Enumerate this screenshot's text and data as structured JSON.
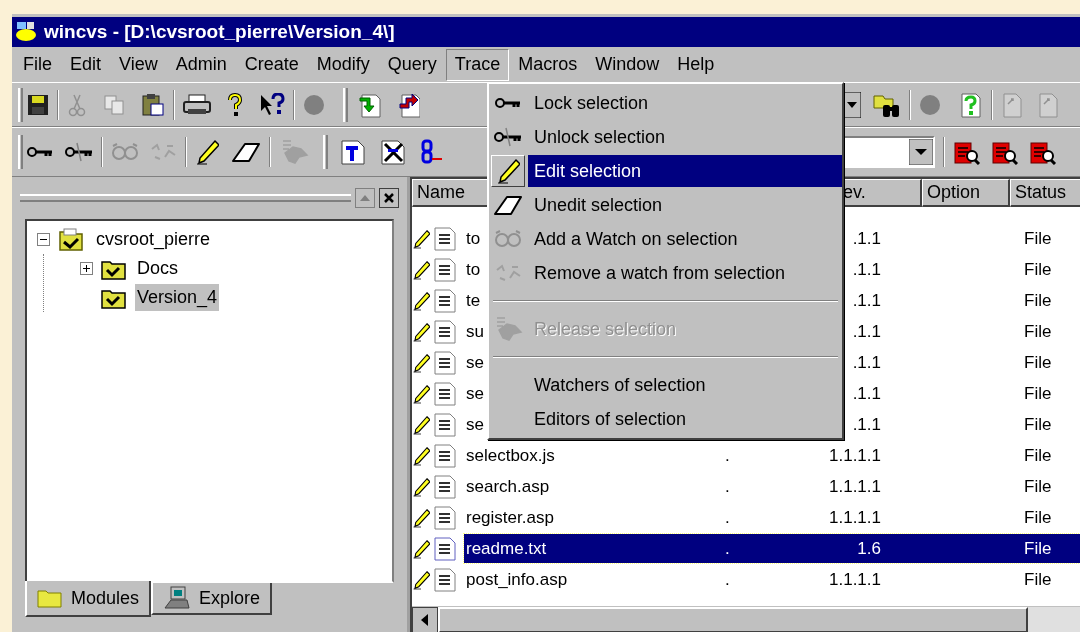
{
  "window": {
    "title": "wincvs - [D:\\cvsroot_pierre\\Version_4\\]"
  },
  "menu_bar": [
    {
      "label": "File",
      "selected": false
    },
    {
      "label": "Edit",
      "selected": false
    },
    {
      "label": "View",
      "selected": false
    },
    {
      "label": "Admin",
      "selected": false
    },
    {
      "label": "Create",
      "selected": false
    },
    {
      "label": "Modify",
      "selected": false
    },
    {
      "label": "Query",
      "selected": false
    },
    {
      "label": "Trace",
      "selected": true
    },
    {
      "label": "Macros",
      "selected": false
    },
    {
      "label": "Window",
      "selected": false
    },
    {
      "label": "Help",
      "selected": false
    }
  ],
  "trace_menu": [
    {
      "kind": "item",
      "label": "Lock selection",
      "selected": false,
      "disabled": false
    },
    {
      "kind": "item",
      "label": "Unlock selection",
      "selected": false,
      "disabled": false
    },
    {
      "kind": "item",
      "label": "Edit selection",
      "selected": true,
      "disabled": false
    },
    {
      "kind": "item",
      "label": "Unedit selection",
      "selected": false,
      "disabled": false
    },
    {
      "kind": "item",
      "label": "Add a Watch on selection",
      "selected": false,
      "disabled": false
    },
    {
      "kind": "item",
      "label": "Remove a watch from selection",
      "selected": false,
      "disabled": false
    },
    {
      "kind": "separator"
    },
    {
      "kind": "item",
      "label": "Release selection",
      "selected": false,
      "disabled": true
    },
    {
      "kind": "separator"
    },
    {
      "kind": "item",
      "label": "Watchers of selection",
      "selected": false,
      "disabled": false
    },
    {
      "kind": "item",
      "label": "Editors of selection",
      "selected": false,
      "disabled": false
    }
  ],
  "module_tree": [
    {
      "label": "cvsroot_pierre",
      "expanded": true,
      "leaf": false,
      "selected": false,
      "children": [
        {
          "label": "Docs",
          "expanded": false,
          "leaf": false,
          "selected": false
        },
        {
          "label": "Version_4",
          "leaf": true,
          "selected": true
        }
      ]
    }
  ],
  "panel_tabs": [
    {
      "label": "Modules",
      "selected": true
    },
    {
      "label": "Explore",
      "selected": false
    }
  ],
  "file_list": {
    "columns": [
      {
        "label": "Name"
      },
      {
        "label": "ev."
      },
      {
        "label": "Option"
      },
      {
        "label": "Status"
      }
    ],
    "rows": [
      {
        "name": "to",
        "rev": ".1.1",
        "status": "File",
        "selected": false
      },
      {
        "name": "to",
        "rev": ".1.1",
        "status": "File",
        "selected": false
      },
      {
        "name": "te",
        "rev": ".1.1",
        "status": "File",
        "selected": false
      },
      {
        "name": "su",
        "rev": ".1.1",
        "status": "File",
        "selected": false
      },
      {
        "name": "se",
        "rev": ".1.1",
        "status": "File",
        "selected": false
      },
      {
        "name": "se",
        "rev": ".1.1",
        "status": "File",
        "selected": false
      },
      {
        "name": "se",
        "rev": ".1.1",
        "status": "File",
        "selected": false
      },
      {
        "name": "selectbox.js",
        "column_2": ".",
        "rev": "1.1.1.1",
        "status": "File",
        "selected": false
      },
      {
        "name": "search.asp",
        "column_2": ".",
        "rev": "1.1.1.1",
        "status": "File",
        "selected": false
      },
      {
        "name": "register.asp",
        "column_2": ".",
        "rev": "1.1.1.1",
        "status": "File",
        "selected": false
      },
      {
        "name": "readme.txt",
        "column_2": ".",
        "rev": "1.6",
        "status": "File",
        "selected": true
      },
      {
        "name": "post_info.asp",
        "column_2": ".",
        "rev": "1.1.1.1",
        "status": "File",
        "selected": false
      }
    ]
  }
}
